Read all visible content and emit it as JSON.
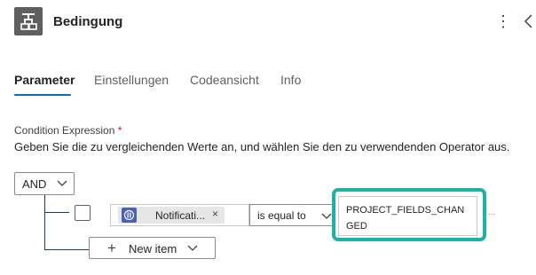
{
  "header": {
    "title": "Bedingung"
  },
  "tabs": [
    {
      "label": "Parameter",
      "active": true
    },
    {
      "label": "Einstellungen",
      "active": false
    },
    {
      "label": "Codeansicht",
      "active": false
    },
    {
      "label": "Info",
      "active": false
    }
  ],
  "condition": {
    "label": "Condition Expression",
    "required_marker": "*",
    "description": "Geben Sie die zu vergleichenden Werte an, und wählen Sie den zu verwendenden Operator aus.",
    "group_operator": "AND",
    "row": {
      "left_token": "Notificati...",
      "remove_glyph": "×",
      "operator": "is equal to",
      "right_value": "PROJECT_FIELDS_CHANGED",
      "more_glyph": "..."
    },
    "new_item_label": "New item"
  },
  "colors": {
    "accent": "#0f6cbd",
    "highlight": "#1cb3a6",
    "token_icon": "#4b5fbf",
    "header_icon_bg": "#5f5f5f"
  }
}
